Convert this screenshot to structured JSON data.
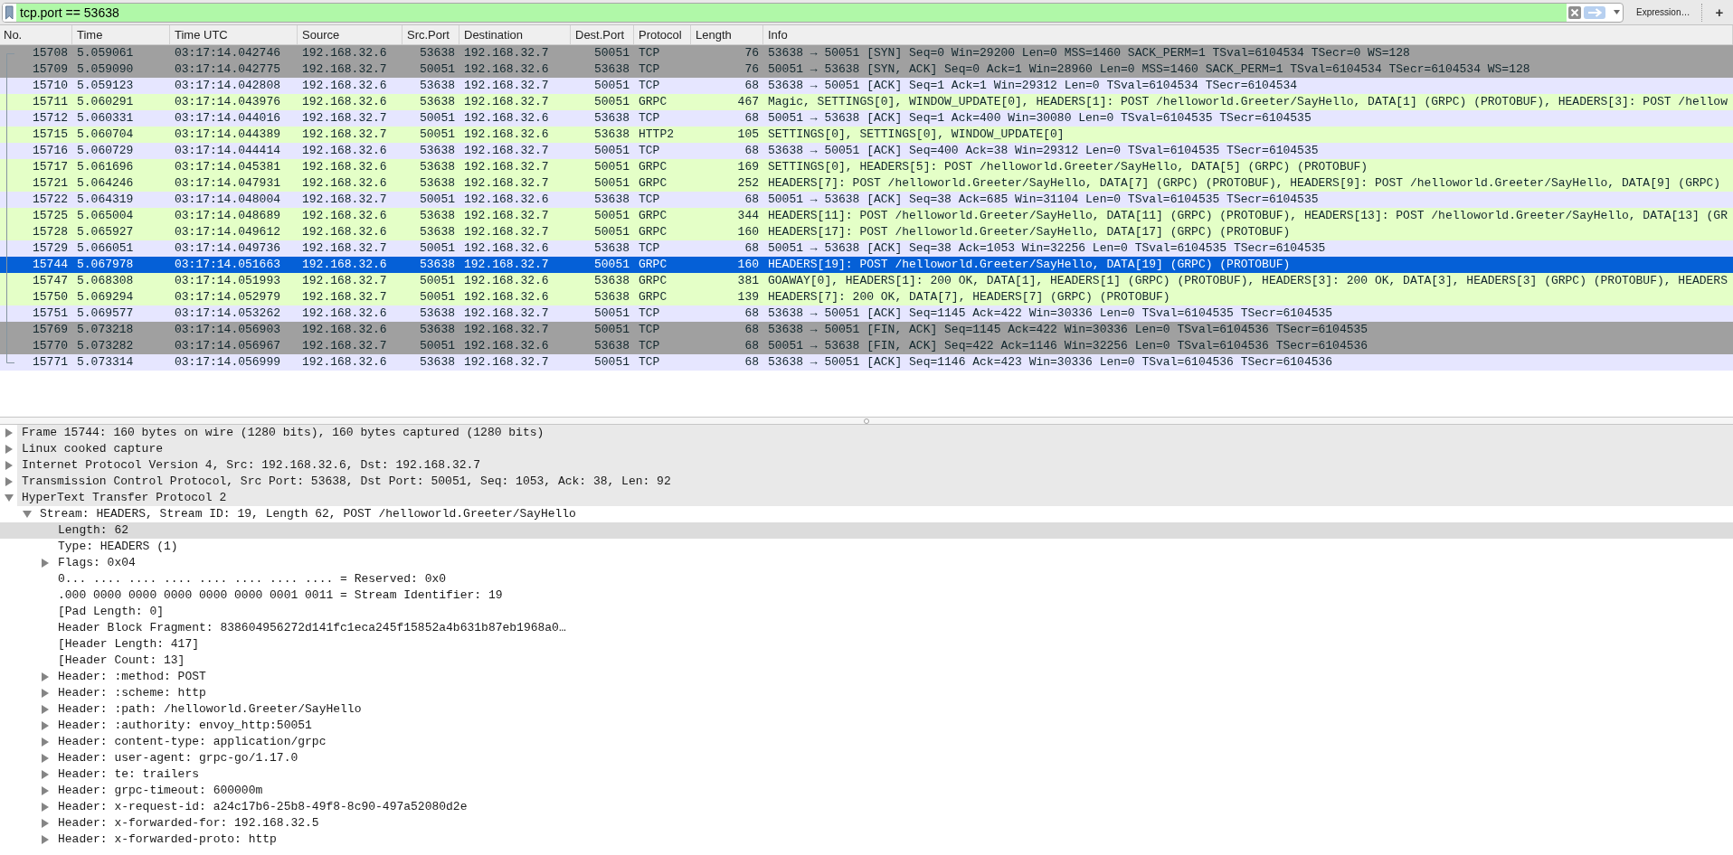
{
  "filter_bar": {
    "value": "tcp.port == 53638",
    "expression_button": "Expression…",
    "add_button": "+"
  },
  "packet_list": {
    "columns": [
      "No.",
      "Time",
      "Time UTC",
      "Source",
      "Src.Port",
      "Destination",
      "Dest.Port",
      "Protocol",
      "Length",
      "Info"
    ],
    "rows": [
      {
        "cells": [
          "15708",
          "5.059061",
          "03:17:14.042746",
          "192.168.32.6",
          "53638",
          "192.168.32.7",
          "50051",
          "TCP",
          "76",
          "53638 → 50051 [SYN] Seq=0 Win=29200 Len=0 MSS=1460 SACK_PERM=1 TSval=6104534 TSecr=0 WS=128"
        ],
        "color": "#a0a0a0",
        "selected": false
      },
      {
        "cells": [
          "15709",
          "5.059090",
          "03:17:14.042775",
          "192.168.32.7",
          "50051",
          "192.168.32.6",
          "53638",
          "TCP",
          "76",
          "50051 → 53638 [SYN, ACK] Seq=0 Ack=1 Win=28960 Len=0 MSS=1460 SACK_PERM=1 TSval=6104534 TSecr=6104534 WS=128"
        ],
        "color": "#a0a0a0",
        "selected": false
      },
      {
        "cells": [
          "15710",
          "5.059123",
          "03:17:14.042808",
          "192.168.32.6",
          "53638",
          "192.168.32.7",
          "50051",
          "TCP",
          "68",
          "53638 → 50051 [ACK] Seq=1 Ack=1 Win=29312 Len=0 TSval=6104534 TSecr=6104534"
        ],
        "color": "#e6e6ff",
        "selected": false
      },
      {
        "cells": [
          "15711",
          "5.060291",
          "03:17:14.043976",
          "192.168.32.6",
          "53638",
          "192.168.32.7",
          "50051",
          "GRPC",
          "467",
          "Magic, SETTINGS[0], WINDOW_UPDATE[0], HEADERS[1]: POST /helloworld.Greeter/SayHello, DATA[1] (GRPC) (PROTOBUF), HEADERS[3]: POST /hellow"
        ],
        "color": "#e4ffc7",
        "selected": false
      },
      {
        "cells": [
          "15712",
          "5.060331",
          "03:17:14.044016",
          "192.168.32.7",
          "50051",
          "192.168.32.6",
          "53638",
          "TCP",
          "68",
          "50051 → 53638 [ACK] Seq=1 Ack=400 Win=30080 Len=0 TSval=6104535 TSecr=6104535"
        ],
        "color": "#e6e6ff",
        "selected": false
      },
      {
        "cells": [
          "15715",
          "5.060704",
          "03:17:14.044389",
          "192.168.32.7",
          "50051",
          "192.168.32.6",
          "53638",
          "HTTP2",
          "105",
          "SETTINGS[0], SETTINGS[0], WINDOW_UPDATE[0]"
        ],
        "color": "#e4ffc7",
        "selected": false
      },
      {
        "cells": [
          "15716",
          "5.060729",
          "03:17:14.044414",
          "192.168.32.6",
          "53638",
          "192.168.32.7",
          "50051",
          "TCP",
          "68",
          "53638 → 50051 [ACK] Seq=400 Ack=38 Win=29312 Len=0 TSval=6104535 TSecr=6104535"
        ],
        "color": "#e6e6ff",
        "selected": false
      },
      {
        "cells": [
          "15717",
          "5.061696",
          "03:17:14.045381",
          "192.168.32.6",
          "53638",
          "192.168.32.7",
          "50051",
          "GRPC",
          "169",
          "SETTINGS[0], HEADERS[5]: POST /helloworld.Greeter/SayHello, DATA[5] (GRPC) (PROTOBUF)"
        ],
        "color": "#e4ffc7",
        "selected": false
      },
      {
        "cells": [
          "15721",
          "5.064246",
          "03:17:14.047931",
          "192.168.32.6",
          "53638",
          "192.168.32.7",
          "50051",
          "GRPC",
          "252",
          "HEADERS[7]: POST /helloworld.Greeter/SayHello, DATA[7] (GRPC) (PROTOBUF), HEADERS[9]: POST /helloworld.Greeter/SayHello, DATA[9] (GRPC)"
        ],
        "color": "#e4ffc7",
        "selected": false
      },
      {
        "cells": [
          "15722",
          "5.064319",
          "03:17:14.048004",
          "192.168.32.7",
          "50051",
          "192.168.32.6",
          "53638",
          "TCP",
          "68",
          "50051 → 53638 [ACK] Seq=38 Ack=685 Win=31104 Len=0 TSval=6104535 TSecr=6104535"
        ],
        "color": "#e6e6ff",
        "selected": false
      },
      {
        "cells": [
          "15725",
          "5.065004",
          "03:17:14.048689",
          "192.168.32.6",
          "53638",
          "192.168.32.7",
          "50051",
          "GRPC",
          "344",
          "HEADERS[11]: POST /helloworld.Greeter/SayHello, DATA[11] (GRPC) (PROTOBUF), HEADERS[13]: POST /helloworld.Greeter/SayHello, DATA[13] (GR"
        ],
        "color": "#e4ffc7",
        "selected": false
      },
      {
        "cells": [
          "15728",
          "5.065927",
          "03:17:14.049612",
          "192.168.32.6",
          "53638",
          "192.168.32.7",
          "50051",
          "GRPC",
          "160",
          "HEADERS[17]: POST /helloworld.Greeter/SayHello, DATA[17] (GRPC) (PROTOBUF)"
        ],
        "color": "#e4ffc7",
        "selected": false
      },
      {
        "cells": [
          "15729",
          "5.066051",
          "03:17:14.049736",
          "192.168.32.7",
          "50051",
          "192.168.32.6",
          "53638",
          "TCP",
          "68",
          "50051 → 53638 [ACK] Seq=38 Ack=1053 Win=32256 Len=0 TSval=6104535 TSecr=6104535"
        ],
        "color": "#e6e6ff",
        "selected": false
      },
      {
        "cells": [
          "15744",
          "5.067978",
          "03:17:14.051663",
          "192.168.32.6",
          "53638",
          "192.168.32.7",
          "50051",
          "GRPC",
          "160",
          "HEADERS[19]: POST /helloworld.Greeter/SayHello, DATA[19] (GRPC) (PROTOBUF)"
        ],
        "selected": true
      },
      {
        "cells": [
          "15747",
          "5.068308",
          "03:17:14.051993",
          "192.168.32.7",
          "50051",
          "192.168.32.6",
          "53638",
          "GRPC",
          "381",
          "GOAWAY[0], HEADERS[1]: 200 OK, DATA[1], HEADERS[1] (GRPC) (PROTOBUF), HEADERS[3]: 200 OK, DATA[3], HEADERS[3] (GRPC) (PROTOBUF), HEADERS"
        ],
        "color": "#e4ffc7",
        "selected": false
      },
      {
        "cells": [
          "15750",
          "5.069294",
          "03:17:14.052979",
          "192.168.32.7",
          "50051",
          "192.168.32.6",
          "53638",
          "GRPC",
          "139",
          "HEADERS[7]: 200 OK, DATA[7], HEADERS[7] (GRPC) (PROTOBUF)"
        ],
        "color": "#e4ffc7",
        "selected": false
      },
      {
        "cells": [
          "15751",
          "5.069577",
          "03:17:14.053262",
          "192.168.32.6",
          "53638",
          "192.168.32.7",
          "50051",
          "TCP",
          "68",
          "53638 → 50051 [ACK] Seq=1145 Ack=422 Win=30336 Len=0 TSval=6104535 TSecr=6104535"
        ],
        "color": "#e6e6ff",
        "selected": false
      },
      {
        "cells": [
          "15769",
          "5.073218",
          "03:17:14.056903",
          "192.168.32.6",
          "53638",
          "192.168.32.7",
          "50051",
          "TCP",
          "68",
          "53638 → 50051 [FIN, ACK] Seq=1145 Ack=422 Win=30336 Len=0 TSval=6104536 TSecr=6104535"
        ],
        "color": "#a0a0a0",
        "selected": false
      },
      {
        "cells": [
          "15770",
          "5.073282",
          "03:17:14.056967",
          "192.168.32.7",
          "50051",
          "192.168.32.6",
          "53638",
          "TCP",
          "68",
          "50051 → 53638 [FIN, ACK] Seq=422 Ack=1146 Win=32256 Len=0 TSval=6104536 TSecr=6104536"
        ],
        "color": "#a0a0a0",
        "selected": false
      },
      {
        "cells": [
          "15771",
          "5.073314",
          "03:17:14.056999",
          "192.168.32.6",
          "53638",
          "192.168.32.7",
          "50051",
          "TCP",
          "68",
          "53638 → 50051 [ACK] Seq=1146 Ack=423 Win=30336 Len=0 TSval=6104536 TSecr=6104536"
        ],
        "color": "#e6e6ff",
        "selected": false
      }
    ]
  },
  "details": {
    "items": [
      {
        "label": "Frame 15744: 160 bytes on wire (1280 bits), 160 bytes captured (1280 bits)",
        "kind": "node",
        "expanded": false,
        "selected": false
      },
      {
        "label": "Linux cooked capture",
        "kind": "node",
        "expanded": false,
        "selected": false
      },
      {
        "label": "Internet Protocol Version 4, Src: 192.168.32.6, Dst: 192.168.32.7",
        "kind": "node",
        "expanded": false,
        "selected": false
      },
      {
        "label": "Transmission Control Protocol, Src Port: 53638, Dst Port: 50051, Seq: 1053, Ack: 38, Len: 92",
        "kind": "node",
        "expanded": false,
        "selected": false
      },
      {
        "label": "HyperText Transfer Protocol 2",
        "kind": "node",
        "expanded": true,
        "selected": false,
        "children": [
          {
            "label": "Stream: HEADERS, Stream ID: 19, Length 62, POST /helloworld.Greeter/SayHello",
            "kind": "node",
            "expanded": true,
            "selected": false,
            "children": [
              {
                "label": "Length: 62",
                "kind": "leaf",
                "selected": true
              },
              {
                "label": "Type: HEADERS (1)",
                "kind": "leaf",
                "selected": false
              },
              {
                "label": "Flags: 0x04",
                "kind": "node",
                "expanded": false,
                "selected": false
              },
              {
                "label": "0... .... .... .... .... .... .... .... = Reserved: 0x0",
                "kind": "leaf",
                "selected": false
              },
              {
                "label": ".000 0000 0000 0000 0000 0000 0001 0011 = Stream Identifier: 19",
                "kind": "leaf",
                "selected": false
              },
              {
                "label": "[Pad Length: 0]",
                "kind": "leaf",
                "selected": false
              },
              {
                "label": "Header Block Fragment: 838604956272d141fc1eca245f15852a4b631b87eb1968a0…",
                "kind": "leaf",
                "selected": false
              },
              {
                "label": "[Header Length: 417]",
                "kind": "leaf",
                "selected": false
              },
              {
                "label": "[Header Count: 13]",
                "kind": "leaf",
                "selected": false
              },
              {
                "label": "Header: :method: POST",
                "kind": "node",
                "expanded": false,
                "selected": false
              },
              {
                "label": "Header: :scheme: http",
                "kind": "node",
                "expanded": false,
                "selected": false
              },
              {
                "label": "Header: :path: /helloworld.Greeter/SayHello",
                "kind": "node",
                "expanded": false,
                "selected": false
              },
              {
                "label": "Header: :authority: envoy_http:50051",
                "kind": "node",
                "expanded": false,
                "selected": false
              },
              {
                "label": "Header: content-type: application/grpc",
                "kind": "node",
                "expanded": false,
                "selected": false
              },
              {
                "label": "Header: user-agent: grpc-go/1.17.0",
                "kind": "node",
                "expanded": false,
                "selected": false
              },
              {
                "label": "Header: te: trailers",
                "kind": "node",
                "expanded": false,
                "selected": false
              },
              {
                "label": "Header: grpc-timeout: 600000m",
                "kind": "node",
                "expanded": false,
                "selected": false
              },
              {
                "label": "Header: x-request-id: a24c17b6-25b8-49f8-8c90-497a52080d2e",
                "kind": "node",
                "expanded": false,
                "selected": false
              },
              {
                "label": "Header: x-forwarded-for: 192.168.32.5",
                "kind": "node",
                "expanded": false,
                "selected": false
              },
              {
                "label": "Header: x-forwarded-proto: http",
                "kind": "node",
                "expanded": false,
                "selected": false
              }
            ]
          }
        ]
      }
    ]
  }
}
